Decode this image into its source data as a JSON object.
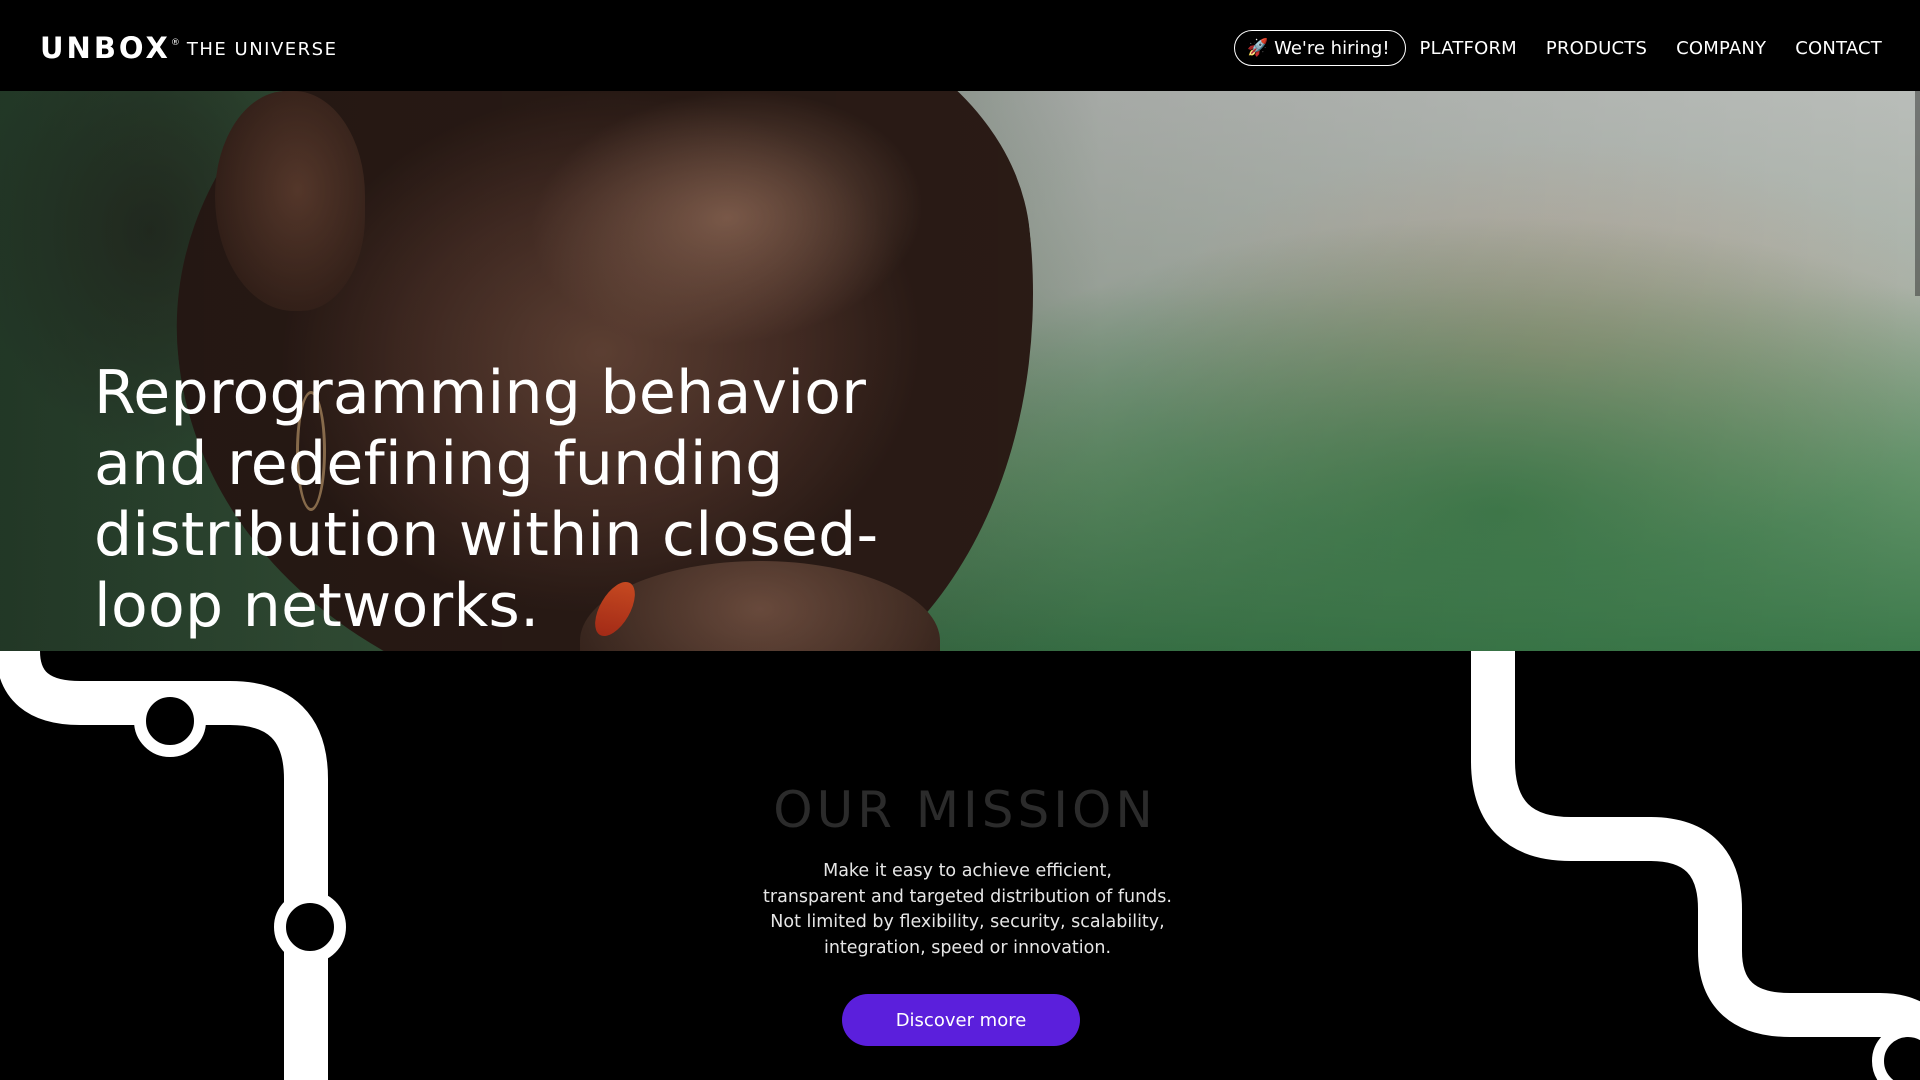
{
  "header": {
    "logo_name": "UNBOX",
    "logo_reg": "®",
    "logo_tagline": "THE UNIVERSE",
    "hiring_icon": "rocket-icon",
    "hiring_label": "We're hiring!",
    "nav": [
      "PLATFORM",
      "PRODUCTS",
      "COMPANY",
      "CONTACT"
    ]
  },
  "hero": {
    "title": "Reprogramming behavior and redefining funding distribution within closed-loop networks."
  },
  "mission": {
    "title": "OUR MISSION",
    "lines": [
      "Make it easy to achieve efficient,",
      "transparent and targeted distribution of funds.",
      "Not limited by flexibility, security, scalability,",
      "integration, speed or innovation."
    ],
    "cta_label": "Discover more"
  },
  "colors": {
    "background": "#000000",
    "accent": "#5b1fdc",
    "text": "#ffffff",
    "mission_title": "#2b2b2b"
  }
}
